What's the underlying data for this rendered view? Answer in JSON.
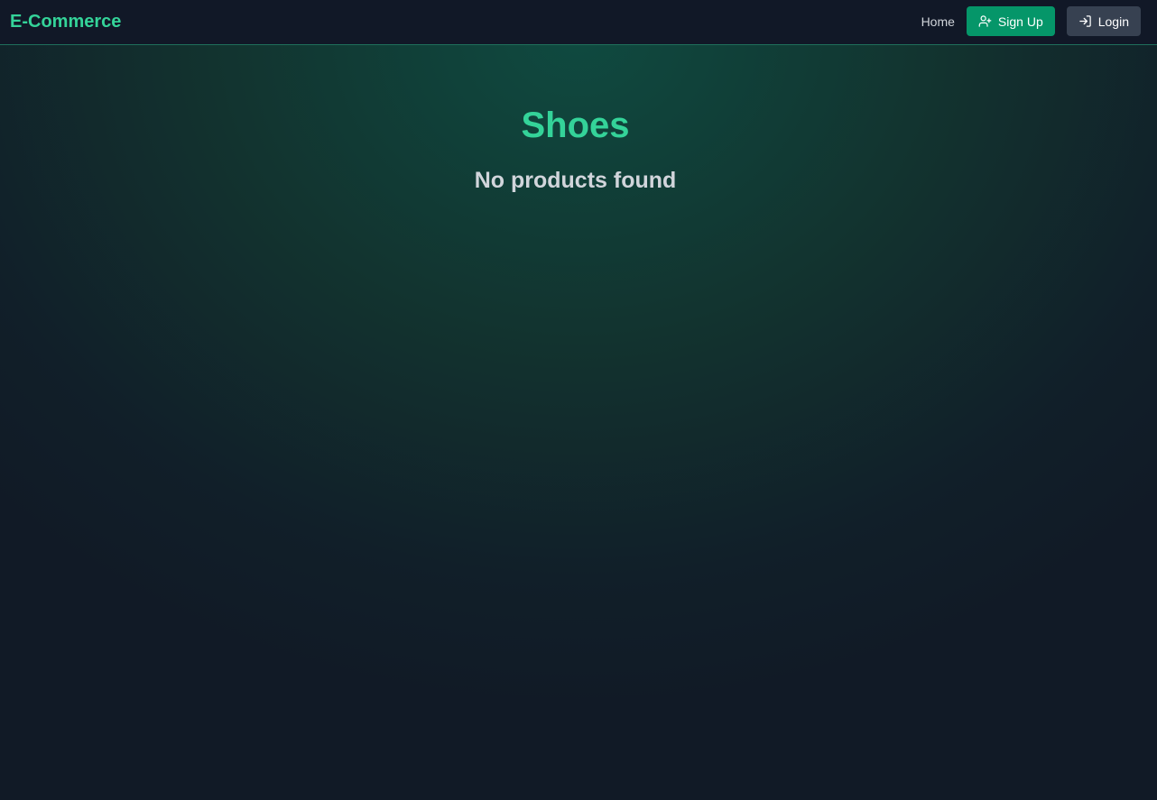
{
  "header": {
    "brand": "E-Commerce",
    "nav": {
      "home_label": "Home",
      "signup_label": "Sign Up",
      "login_label": "Login"
    }
  },
  "main": {
    "category_title": "Shoes",
    "empty_message": "No products found"
  },
  "colors": {
    "accent": "#34d399",
    "signup_button": "#059669",
    "login_button": "#374151",
    "navbar_bg": "#111827"
  },
  "icons": {
    "signup": "user-plus-icon",
    "login": "log-in-icon"
  }
}
